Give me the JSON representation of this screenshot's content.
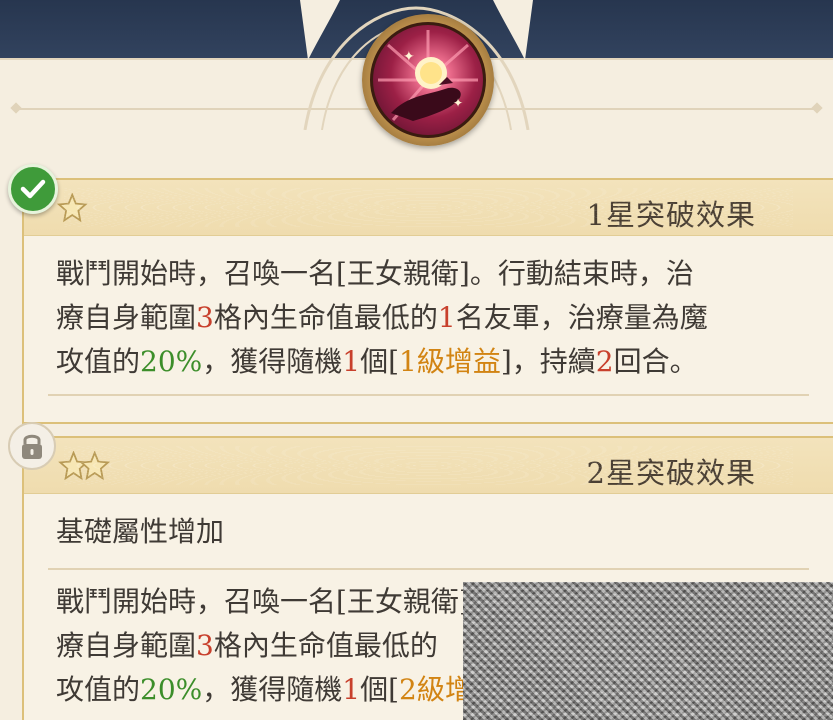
{
  "colors": {
    "top_band": "#27364f",
    "panel": "#f5eee0",
    "card_border": "#dcc07a",
    "number_red": "#c8402c",
    "percent_green": "#3c8e2a",
    "buff_gold": "#d28413",
    "check_green": "#3f9b3a"
  },
  "skill_icon": "glowing-orb-hand-icon",
  "sections": [
    {
      "title": "1星突破效果",
      "stars": 1,
      "status": "unlocked",
      "status_icon": "check-icon",
      "line1": {
        "a": "戰鬥開始時，召喚一名[王女親衛]。行動結束時，治"
      },
      "line2": {
        "a": "療自身範圍",
        "n1": "3",
        "b": "格內生命值最低的",
        "n2": "1",
        "c": "名友軍，治療量為魔"
      },
      "line3": {
        "a": "攻值的",
        "pct": "20%",
        "b": "，獲得隨機",
        "n1": "1",
        "c": "個[",
        "buff": "1級增益",
        "d": "]，持續",
        "n2": "2",
        "e": "回合。"
      }
    },
    {
      "title": "2星突破效果",
      "stars": 2,
      "status": "locked",
      "status_icon": "lock-icon",
      "subtitle": "基礎屬性增加",
      "line1": {
        "a": "戰鬥開始時，召喚一名[王女親衛]。"
      },
      "line2": {
        "a": "療自身範圍",
        "n1": "3",
        "b": "格內生命值最低的"
      },
      "line3": {
        "a": "攻值的",
        "pct": "20%",
        "b": "，獲得隨機",
        "n1": "1",
        "c": "個[",
        "buff": "2級增益"
      }
    }
  ]
}
